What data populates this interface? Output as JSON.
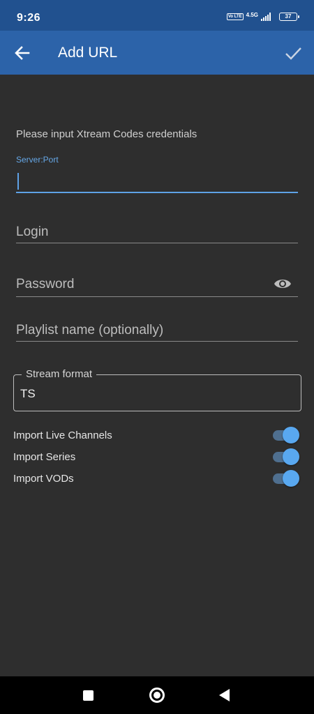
{
  "status_bar": {
    "time": "9:26",
    "volte": "Vo LTE",
    "network": "4.5G",
    "battery": "37"
  },
  "app_bar": {
    "title": "Add URL",
    "back_icon": "arrow-back-icon",
    "confirm_icon": "check-icon"
  },
  "form": {
    "prompt": "Please input Xtream Codes credentials",
    "server": {
      "label": "Server:Port",
      "value": ""
    },
    "login": {
      "placeholder": "Login",
      "value": ""
    },
    "password": {
      "placeholder": "Password",
      "value": "",
      "toggle_icon": "eye-icon"
    },
    "playlist": {
      "placeholder": "Playlist name (optionally)",
      "value": ""
    },
    "stream_format": {
      "label": "Stream format",
      "value": "TS"
    }
  },
  "toggles": [
    {
      "label": "Import Live Channels",
      "on": true
    },
    {
      "label": "Import Series",
      "on": true
    },
    {
      "label": "Import VODs",
      "on": true
    }
  ],
  "colors": {
    "status_bar": "#21518f",
    "app_bar": "#2c63a9",
    "background": "#2e2e2e",
    "accent": "#5ea2e6"
  }
}
